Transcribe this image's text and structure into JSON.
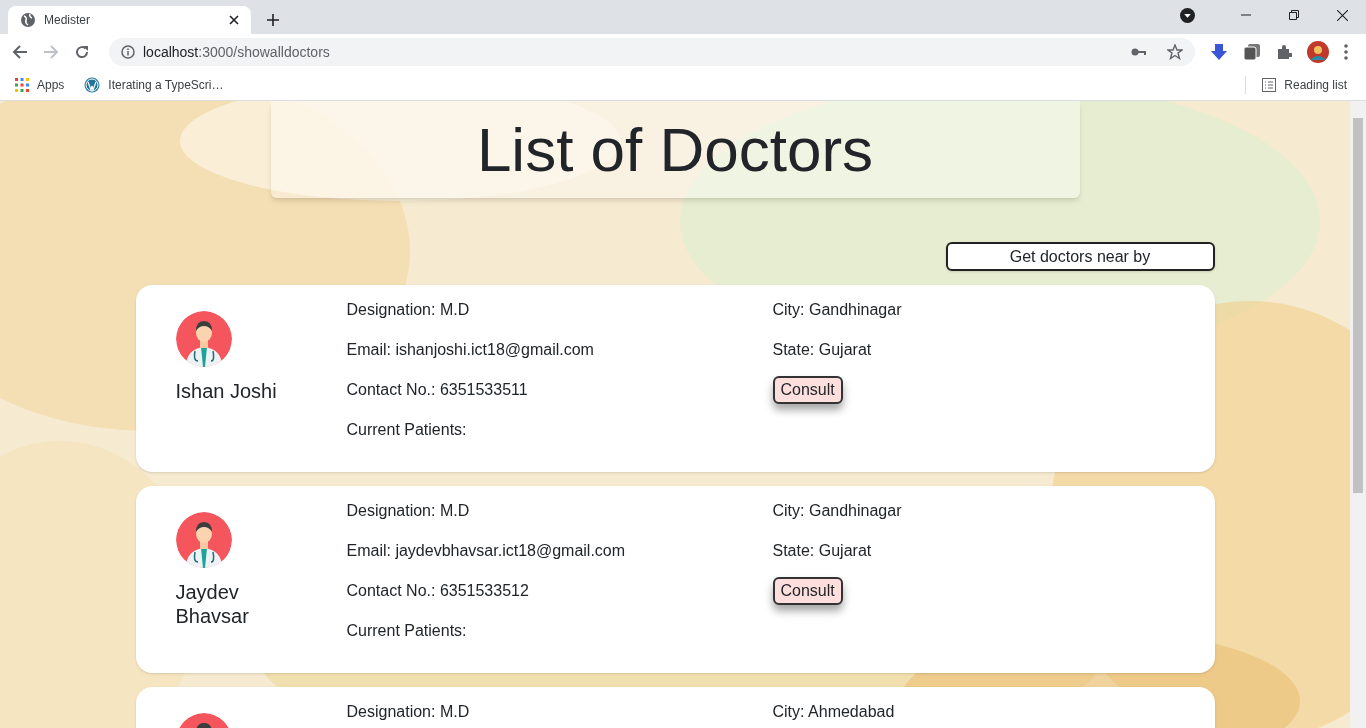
{
  "browser": {
    "tab_title": "Medister",
    "address_host": "localhost",
    "address_path": ":3000/showalldoctors",
    "bookmarks": [
      "Apps",
      "Iterating a TypeScri…"
    ],
    "reading_list": "Reading list"
  },
  "page": {
    "title": "List of Doctors",
    "nearby_button": "Get doctors near by",
    "doctors": [
      {
        "name": "Ishan Joshi",
        "designation": "Designation: M.D",
        "email": "Email: ishanjoshi.ict18@gmail.com",
        "contact": "Contact No.: 6351533511",
        "patients": "Current Patients:",
        "city": "City: Gandhinagar",
        "state": "State: Gujarat",
        "consult": "Consult"
      },
      {
        "name": "Jaydev Bhavsar",
        "designation": "Designation: M.D",
        "email": "Email: jaydevbhavsar.ict18@gmail.com",
        "contact": "Contact No.: 6351533512",
        "patients": "Current Patients:",
        "city": "City: Gandhinagar",
        "state": "State: Gujarat",
        "consult": "Consult"
      },
      {
        "designation": "Designation: M.D",
        "city": "City: Ahmedabad"
      }
    ]
  }
}
